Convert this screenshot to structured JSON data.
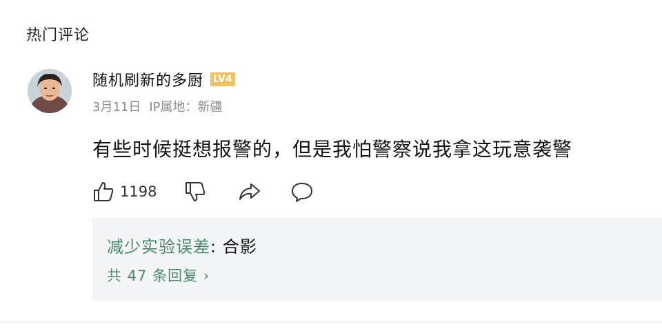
{
  "section": {
    "title": "热门评论"
  },
  "comment": {
    "avatar_icon": "user-avatar",
    "username": "随机刷新的多厨",
    "level_badge": "LV4",
    "date": "3月11日",
    "ip_location": "IP属地：新疆",
    "text": "有些时候挺想报警的，但是我怕警察说我拿这玩意袭警",
    "likes": "1198",
    "actions": {
      "like_icon": "thumbs-up-icon",
      "dislike_icon": "thumbs-down-icon",
      "share_icon": "share-icon",
      "reply_icon": "comment-bubble-icon"
    }
  },
  "replies": {
    "preview_user": "减少实验误差",
    "preview_separator": ": ",
    "preview_text": "合影",
    "count_label": "共 47 条回复 ›"
  },
  "colors": {
    "reply_accent": "#4a8a6c",
    "badge": "#f3c15b",
    "meta_text": "#8a8a8a",
    "reply_bg": "#f4f5f7"
  }
}
